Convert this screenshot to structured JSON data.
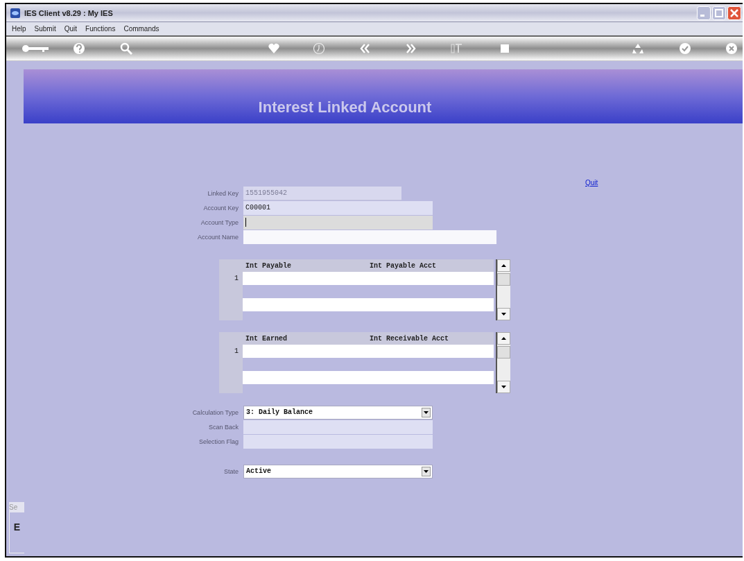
{
  "window": {
    "title": "IES Client v8.29 : My IES"
  },
  "menu": [
    "Help",
    "Submit",
    "Quit",
    "Functions",
    "Commands"
  ],
  "banner": {
    "title": "Interest Linked Account"
  },
  "quit_link": "Quit",
  "account_fields": [
    {
      "label": "Linked Key",
      "value": "1551955042",
      "kind": "text",
      "disabled": true,
      "focused": false
    },
    {
      "label": "Account Key",
      "value": "C00001",
      "kind": "text",
      "disabled": false,
      "focused": false
    },
    {
      "label": "Account Type",
      "kind": "text",
      "disabled": false,
      "focused": true
    },
    {
      "label": "Account Name",
      "kind": "text",
      "disabled": false,
      "focused": false
    }
  ],
  "grids": [
    {
      "columns": [
        "Int Payable",
        "Int Payable Acct"
      ],
      "row_numbers": [
        "1"
      ]
    },
    {
      "columns": [
        "Int Earned",
        "Int Receivable Acct"
      ],
      "row_numbers": [
        "1"
      ]
    }
  ],
  "calculation_fields": [
    {
      "label": "Calculation Type",
      "value": "3: Daily Balance",
      "kind": "select",
      "disabled": false,
      "focused": false
    },
    {
      "label": "Scan Back",
      "kind": "text",
      "disabled": false,
      "focused": false
    },
    {
      "label": "Selection Flag",
      "kind": "text",
      "disabled": false,
      "focused": false
    },
    {
      "label": "State",
      "value": "Active",
      "kind": "select",
      "disabled": false,
      "focused": false
    }
  ],
  "side_panel": {
    "tab": "Se",
    "label": "E"
  }
}
